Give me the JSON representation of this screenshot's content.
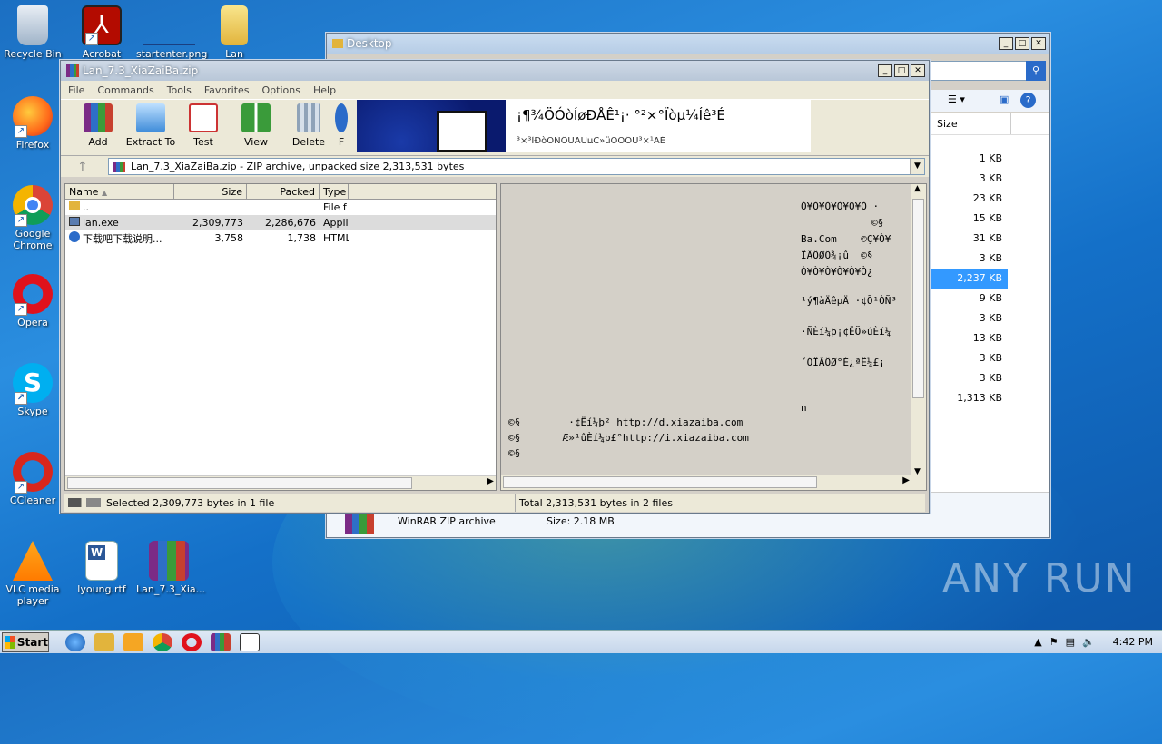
{
  "desktop_icons": [
    {
      "label": "Recycle Bin"
    },
    {
      "label": "Acrobat"
    },
    {
      "label": "startenter.png"
    },
    {
      "label": "Lan"
    },
    {
      "label": "Firefox"
    },
    {
      "label": "Google Chrome"
    },
    {
      "label": "Opera"
    },
    {
      "label": "Skype"
    },
    {
      "label": "CCleaner"
    },
    {
      "label": "VLC media player"
    },
    {
      "label": "lyoung.rtf"
    },
    {
      "label": "Lan_7.3_Xia..."
    }
  ],
  "explorer": {
    "title": "Desktop",
    "size_header": "Size",
    "sizes": [
      "1 KB",
      "3 KB",
      "23 KB",
      "15 KB",
      "31 KB",
      "3 KB",
      "2,237 KB",
      "9 KB",
      "3 KB",
      "13 KB",
      "3 KB",
      "3 KB",
      "1,313 KB"
    ],
    "selected_index": 6,
    "details_type": "WinRAR ZIP archive",
    "details_size": "Size: 2.18 MB"
  },
  "winrar": {
    "title": "Lan_7.3_XiaZaiBa.zip",
    "menu": [
      "File",
      "Commands",
      "Tools",
      "Favorites",
      "Options",
      "Help"
    ],
    "tools": [
      "Add",
      "Extract To",
      "Test",
      "View",
      "Delete",
      "F"
    ],
    "banner_title": "¡¶¾ÖÓòÍøÐÅÊ¹¡· °²×°Ïòµ¼Íê³É",
    "banner_sub": "³×³ÌÐòÒÑÕÛÄÚµÇ»üÓÖÕÛ³×¹ÄÉ",
    "path": "Lan_7.3_XiaZaiBa.zip - ZIP archive, unpacked size 2,313,531 bytes",
    "columns": [
      "Name",
      "Size",
      "Packed",
      "Type"
    ],
    "files": [
      {
        "name": "..",
        "size": "",
        "packed": "",
        "type": "File f"
      },
      {
        "name": "lan.exe",
        "size": "2,309,773",
        "packed": "2,286,676",
        "type": "Appli"
      },
      {
        "name": "下载吧下载说明...",
        "size": "3,758",
        "packed": "1,738",
        "type": "HTML"
      }
    ],
    "comment_lines": [
      "Ò¥Ò¥Ò¥Ò¥Ò¥Ò ·",
      "©§",
      "Ba.Com    ©Ç¥Ò¥",
      "ÏÂÔØÕ¾¡û  ©§",
      "Ò¥Ò¥Ò¥Ò¥Ò¥Ò¿",
      "¹ý¶àÄêµÄ ·¢Õ¹ÒÑ³",
      "·ÑÈí¼þ¡¢ËÖ»úÈí¼",
      "´ÓÏÂÔØ°É¿ªÊ¼£¡",
      "n",
      "©§        ·¢Ëí¼þ² http://d.xiazaiba.com",
      "©§       Æ»¹ûÈí¼þ£°http://i.xiazaiba.com",
      "©§"
    ],
    "status_left": "Selected 2,309,773 bytes in 1 file",
    "status_right": "Total 2,313,531 bytes in 2 files"
  },
  "taskbar": {
    "start": "Start",
    "time": "4:42 PM"
  },
  "watermark": "ANY RUN"
}
